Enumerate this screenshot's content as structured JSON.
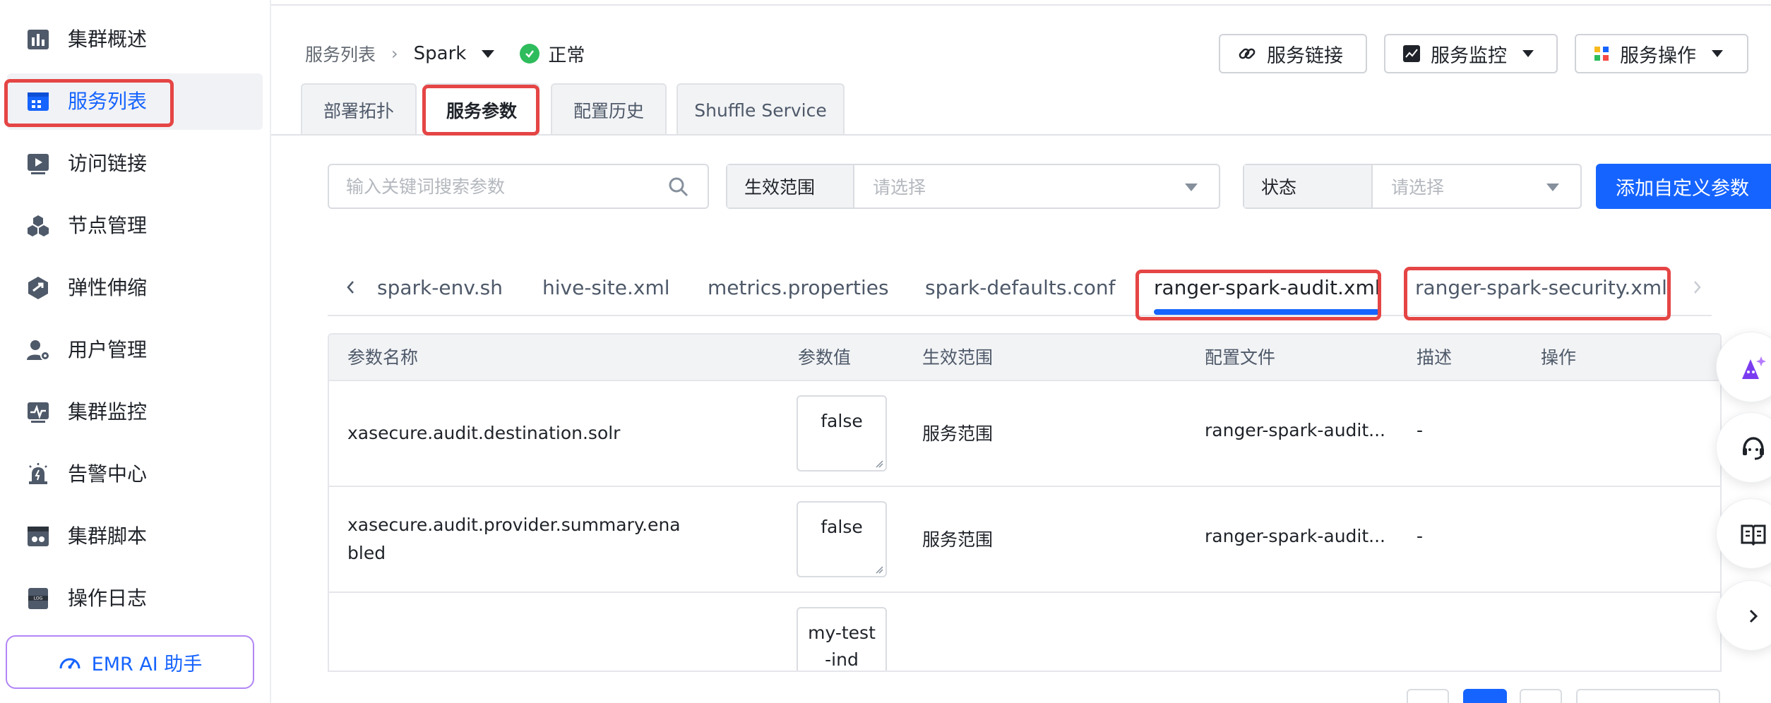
{
  "sidebar": {
    "items": [
      {
        "label": "集群概述",
        "icon": "bar-chart-icon"
      },
      {
        "label": "服务列表",
        "icon": "service-list-icon"
      },
      {
        "label": "访问链接",
        "icon": "access-link-icon"
      },
      {
        "label": "节点管理",
        "icon": "nodes-icon"
      },
      {
        "label": "弹性伸缩",
        "icon": "auto-scaling-icon"
      },
      {
        "label": "用户管理",
        "icon": "user-gear-icon"
      },
      {
        "label": "集群监控",
        "icon": "monitor-icon"
      },
      {
        "label": "告警中心",
        "icon": "alarm-icon"
      },
      {
        "label": "集群脚本",
        "icon": "script-icon"
      },
      {
        "label": "操作日志",
        "icon": "log-icon"
      }
    ],
    "active_index": 1,
    "ai_assistant": "EMR AI 助手"
  },
  "header": {
    "breadcrumb_root": "服务列表",
    "service": "Spark",
    "status": "正常",
    "buttons": {
      "service_link": "服务链接",
      "service_monitor": "服务监控",
      "service_ops": "服务操作"
    }
  },
  "tabs": [
    "部署拓扑",
    "服务参数",
    "配置历史",
    "Shuffle Service"
  ],
  "active_tab": "服务参数",
  "filters": {
    "search_placeholder": "输入关键词搜索参数",
    "scope_label": "生效范围",
    "scope_placeholder": "请选择",
    "status_label": "状态",
    "status_placeholder": "请选择",
    "add_button": "添加自定义参数"
  },
  "file_tabs": [
    "spark-env.sh",
    "hive-site.xml",
    "metrics.properties",
    "spark-defaults.conf",
    "ranger-spark-audit.xml",
    "ranger-spark-security.xml"
  ],
  "active_file_tab": "ranger-spark-audit.xml",
  "table": {
    "columns": [
      "参数名称",
      "参数值",
      "生效范围",
      "配置文件",
      "描述",
      "操作"
    ],
    "rows": [
      {
        "name": "xasecure.audit.destination.solr",
        "value": "false",
        "scope": "服务范围",
        "file": "ranger-spark-audit...",
        "desc": "-"
      },
      {
        "name": "xasecure.audit.provider.summary.enabled",
        "value": "false",
        "scope": "服务范围",
        "file": "ranger-spark-audit...",
        "desc": "-"
      },
      {
        "name": "",
        "value": "my-test-ind",
        "scope": "",
        "file": "",
        "desc": ""
      }
    ]
  },
  "colors": {
    "accent": "#1664ff",
    "highlight": "#e54545",
    "ok": "#2ebc5c"
  }
}
